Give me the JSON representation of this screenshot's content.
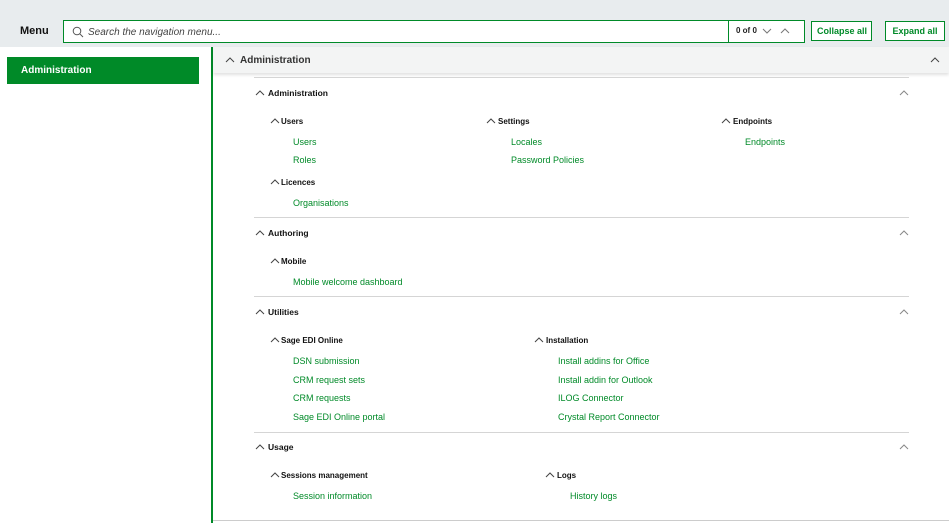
{
  "header": {
    "menu_label": "Menu",
    "search_placeholder": "Search the navigation menu...",
    "result_count": "0 of 0",
    "collapse_all_label": "Collapse all",
    "expand_all_label": "Expand all"
  },
  "sidebar": {
    "items": [
      {
        "label": "Administration",
        "active": true
      }
    ]
  },
  "main": {
    "title": "Administration",
    "sections": [
      {
        "title": "Administration",
        "groups": [
          {
            "title": "Users",
            "links": [
              "Users",
              "Roles"
            ]
          },
          {
            "title": "Settings",
            "links": [
              "Locales",
              "Password Policies"
            ]
          },
          {
            "title": "Endpoints",
            "links": [
              "Endpoints"
            ]
          },
          {
            "title": "Licences",
            "links": [
              "Organisations"
            ]
          }
        ]
      },
      {
        "title": "Authoring",
        "groups": [
          {
            "title": "Mobile",
            "links": [
              "Mobile welcome dashboard"
            ]
          }
        ]
      },
      {
        "title": "Utilities",
        "groups": [
          {
            "title": "Sage EDI Online",
            "links": [
              "DSN submission",
              "CRM request sets",
              "CRM requests",
              "Sage EDI Online portal"
            ]
          },
          {
            "title": "Installation",
            "links": [
              "Install addins for Office",
              "Install addin for Outlook",
              "ILOG Connector",
              "Crystal Report Connector"
            ]
          }
        ]
      },
      {
        "title": "Usage",
        "groups": [
          {
            "title": "Sessions management",
            "links": [
              "Session information"
            ]
          },
          {
            "title": "Logs",
            "links": [
              "History logs"
            ]
          }
        ]
      }
    ]
  },
  "colors": {
    "accent": "#008a28",
    "topbar_bg": "#e8ecee"
  },
  "icons": {
    "search": "search-icon",
    "chevron_up": "chevron-up-icon",
    "chevron_down": "chevron-down-icon"
  }
}
